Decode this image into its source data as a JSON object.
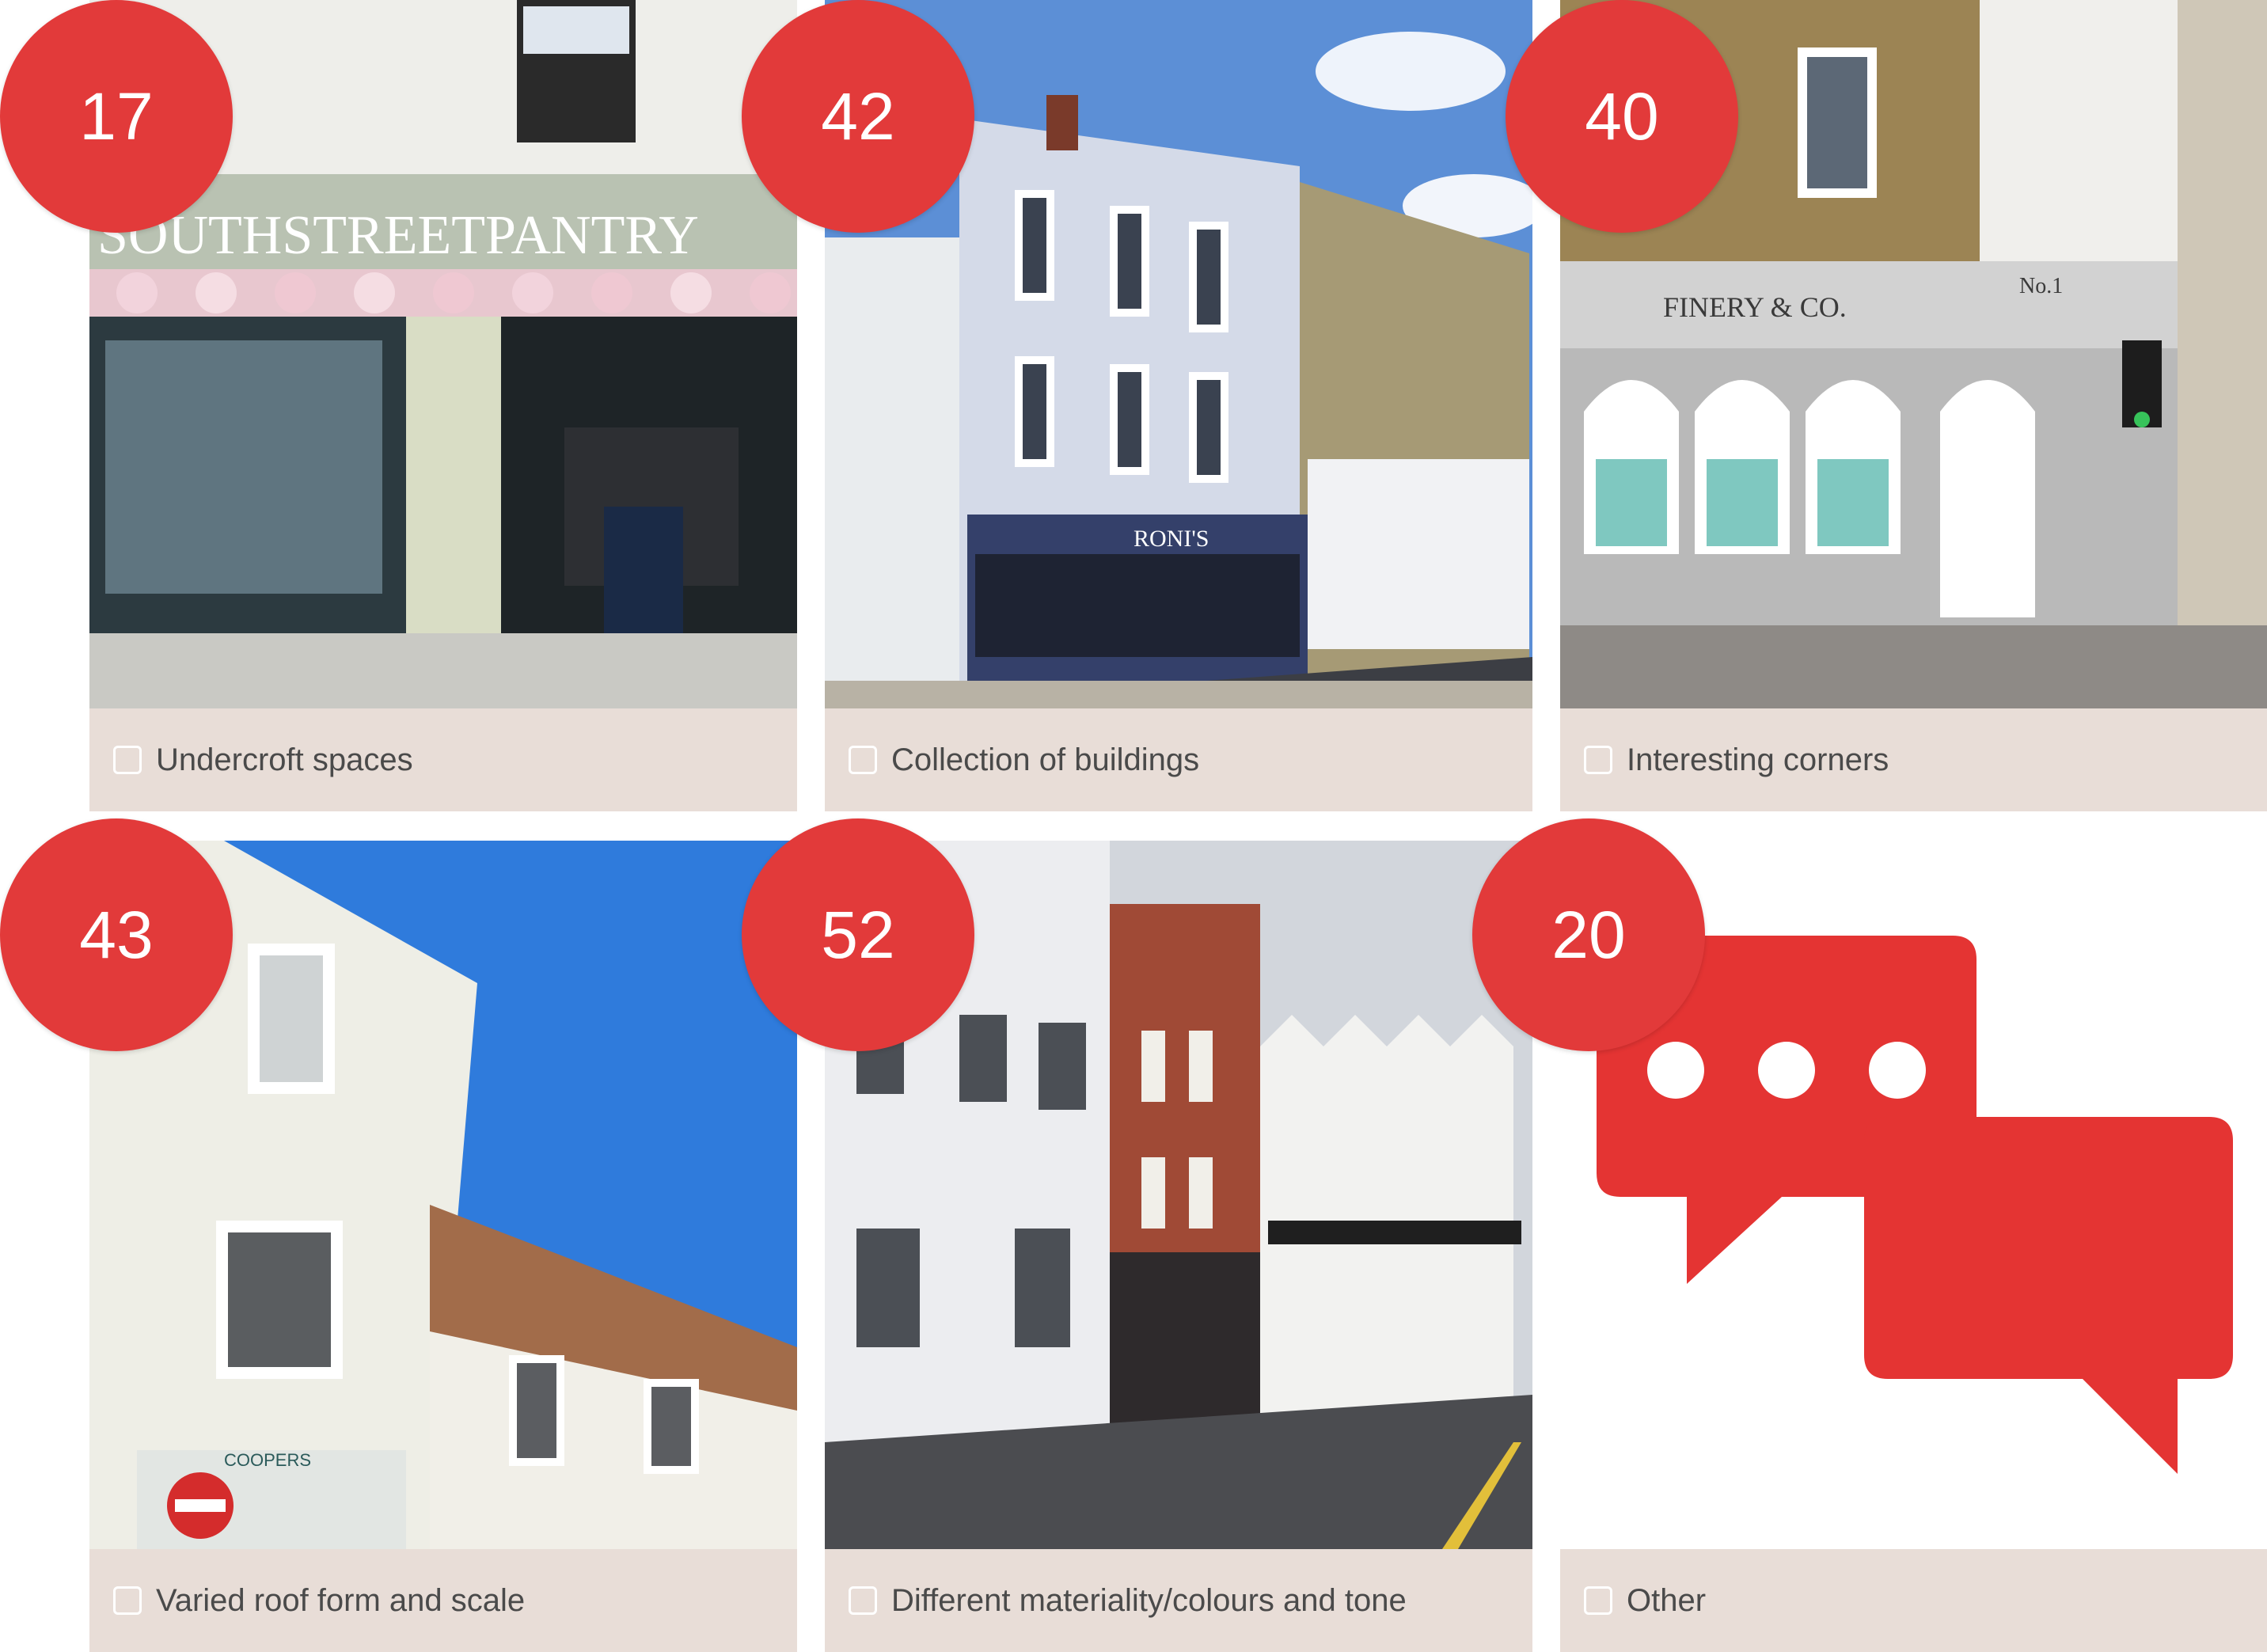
{
  "options": [
    {
      "label": "Undercroft spaces",
      "count": "17",
      "shop_sign": "SOUTHSTREETPANTRY"
    },
    {
      "label": "Collection of buildings",
      "count": "42",
      "shop_sign": "RONI'S"
    },
    {
      "label": "Interesting corners",
      "count": "40",
      "shop_sign": "FINERY & CO.",
      "shop_sign_2": "No.1"
    },
    {
      "label": "Varied roof form and scale",
      "count": "43",
      "shop_sign": "COOPERS"
    },
    {
      "label": "Different materiality/colours and tone",
      "count": "52"
    },
    {
      "label": "Other",
      "count": "20",
      "icon": "chat-bubbles-icon"
    }
  ],
  "colors": {
    "badge": "#e23a3a",
    "card_bg": "#e8ddd7",
    "label_text": "#4a4a4a",
    "icon_red": "#e43433"
  }
}
